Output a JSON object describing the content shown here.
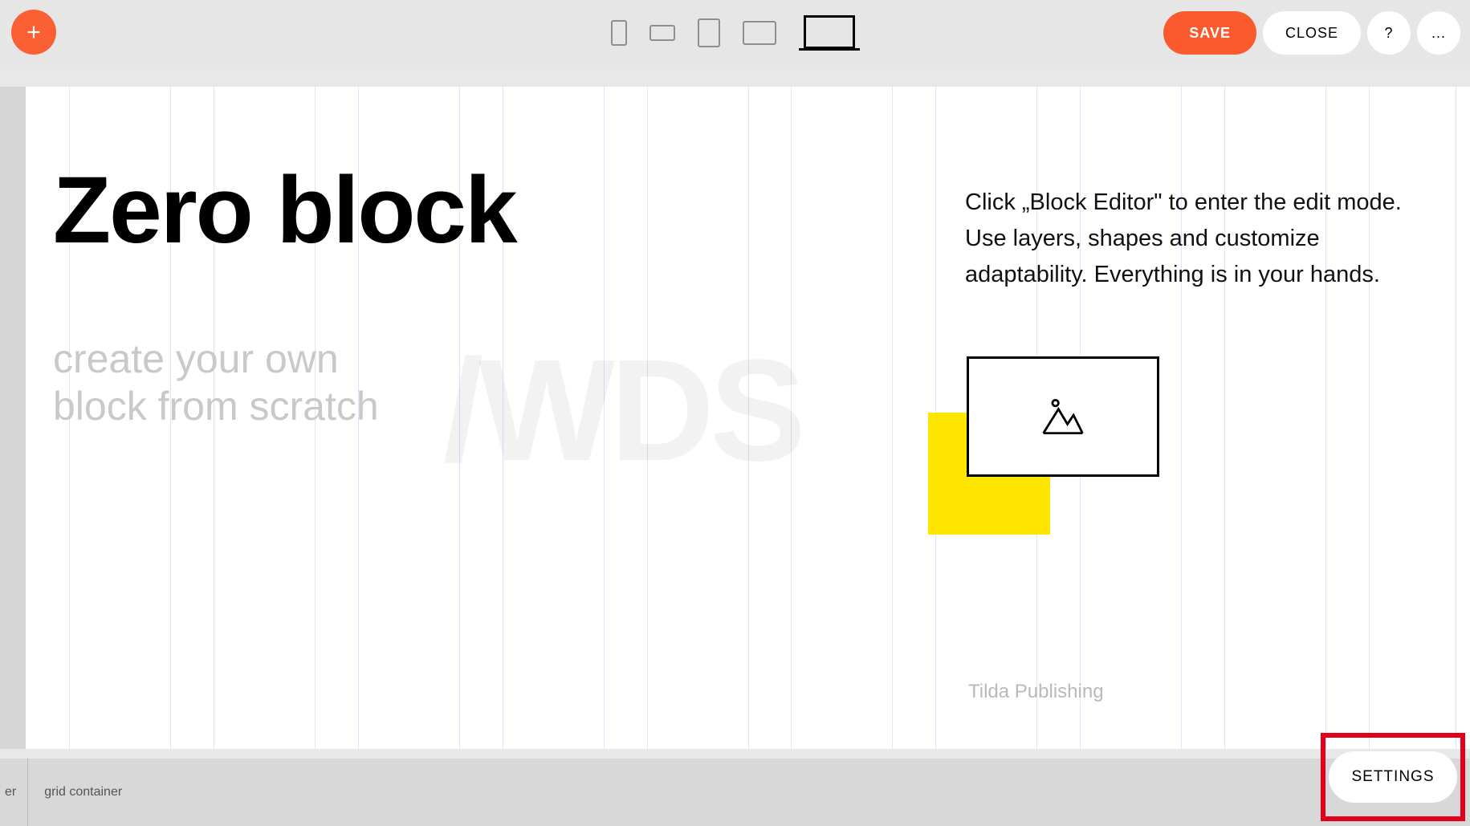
{
  "toolbar": {
    "save_label": "SAVE",
    "close_label": "CLOSE",
    "help_label": "?",
    "more_label": "..."
  },
  "content": {
    "hero_title": "Zero block",
    "hero_sub_line1": "create your own",
    "hero_sub_line2": "block from scratch",
    "description": "Click „Block Editor\" to enter the edit mode. Use layers, shapes and customize adaptability. Everything is in your hands.",
    "watermark": "/WDS",
    "credit": "Tilda Publishing"
  },
  "bottombar": {
    "crumb_cut": "er",
    "crumb_grid": "grid container",
    "settings_label": "SETTINGS"
  },
  "colors": {
    "accent": "#fa5a2d",
    "highlight_yellow": "#ffe600",
    "annotation_red": "#e2001a"
  }
}
